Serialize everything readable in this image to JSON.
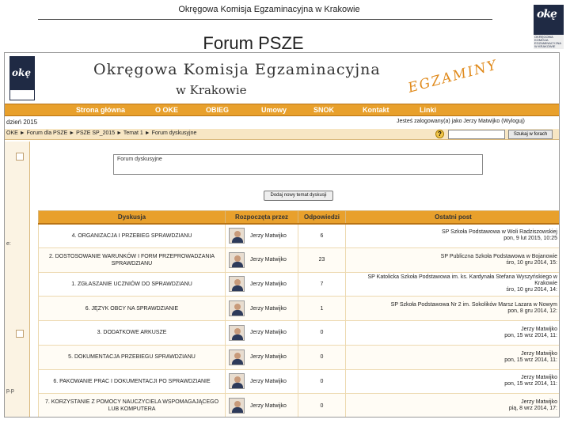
{
  "slide": {
    "header": "Okręgowa Komisja Egzaminacyjna w Krakowie",
    "title": "Forum PSZE",
    "corner_logo": {
      "mark": "okę",
      "text": "OKRĘGOWA KOMISJA EGZAMINACYJNA W KRAKOWIE"
    }
  },
  "site": {
    "logo": {
      "mark": "okę",
      "text": "OKRĘGOWA KOMISJA EGZAMINACYJNA W KRAKOWIE"
    },
    "title_line1": "Okręgowa Komisja Egzaminacyjna",
    "title_line2": "w Krakowie",
    "tagline": "EGZAMINY",
    "nav": [
      "Strona główna",
      "O OKE",
      "OBIEG",
      "Umowy",
      "SNOK",
      "Kontakt",
      "Linki"
    ],
    "date_text": "dzień 2015",
    "login_text": "Jesteś zalogowany(a) jako Jerzy Matwijko (Wyloguj)",
    "breadcrumb": "OKE ► Forum dla PSZE ► PSZE SP_2015 ► Temat 1 ► Forum dyskusyjne",
    "help_icon": "?",
    "search_button": "Szukaj w forach",
    "forum_label": "Forum dyskusyjne",
    "new_topic_button": "Dodaj nowy temat dyskusji",
    "sidebar_text": [
      "e:",
      "p.p"
    ]
  },
  "table": {
    "headers": [
      "Dyskusja",
      "Rozpoczęta przez",
      "Odpowiedzi",
      "Ostatni post"
    ],
    "rows": [
      {
        "topic": "4. ORGANIZACJA I PRZEBIEG SPRAWDZIANU",
        "author": "Jerzy Matwijko",
        "replies": "6",
        "last_line1": "SP Szkoła Podstawowa w Woli Radziszowskiej",
        "last_line2": "pon, 9 lut 2015, 10:25"
      },
      {
        "topic": "2. DOSTOSOWANIE WARUNKÓW I FORM PRZEPROWADZANIA SPRAWDZIANU",
        "author": "Jerzy Matwijko",
        "replies": "23",
        "last_line1": "SP Publiczna Szkoła Podstawowa w Bojanowie",
        "last_line2": "śro, 10 gru 2014, 15:"
      },
      {
        "topic": "1. ZGŁASZANIE UCZNIÓW DO SPRAWDZIANU",
        "author": "Jerzy Matwijko",
        "replies": "7",
        "last_line1": "SP Katolicka Szkoła Podstawowa im. ks. Kardynała Stefana Wyszyńskiego w Krakowie",
        "last_line2": "śro, 10 gru 2014, 14:"
      },
      {
        "topic": "6. JĘZYK OBCY NA SPRAWDZIANIE",
        "author": "Jerzy Matwijko",
        "replies": "1",
        "last_line1": "SP Szkoła Podstawowa Nr 2 im. Sokolików Marsz Lazara w Nowym",
        "last_line2": "pon, 8 gru 2014, 12:"
      },
      {
        "topic": "3. DODATKOWE ARKUSZE",
        "author": "Jerzy Matwijko",
        "replies": "0",
        "last_line1": "Jerzy Matwijko",
        "last_line2": "pon, 15 wrz 2014, 11:"
      },
      {
        "topic": "5. DOKUMENTACJA PRZEBIEGU SPRAWDZIANU",
        "author": "Jerzy Matwijko",
        "replies": "0",
        "last_line1": "Jerzy Matwijko",
        "last_line2": "pon, 15 wrz 2014, 11:"
      },
      {
        "topic": "6. PAKOWANIE PRAC I DOKUMENTACJI PO SPRAWDZIANIE",
        "author": "Jerzy Matwijko",
        "replies": "0",
        "last_line1": "Jerzy Matwijko",
        "last_line2": "pon, 15 wrz 2014, 11:"
      },
      {
        "topic": "7. KORZYSTANIE Z POMOCY NAUCZYCIELA WSPOMAGAJĄCEGO LUB KOMPUTERA",
        "author": "Jerzy Matwijko",
        "replies": "0",
        "last_line1": "Jerzy Matwijko",
        "last_line2": "pią, 8 wrz 2014, 17:"
      }
    ]
  },
  "colors": {
    "accent_orange": "#e8a02c",
    "row_border": "#edd9b0",
    "logo_navy": "#1f2a44"
  }
}
